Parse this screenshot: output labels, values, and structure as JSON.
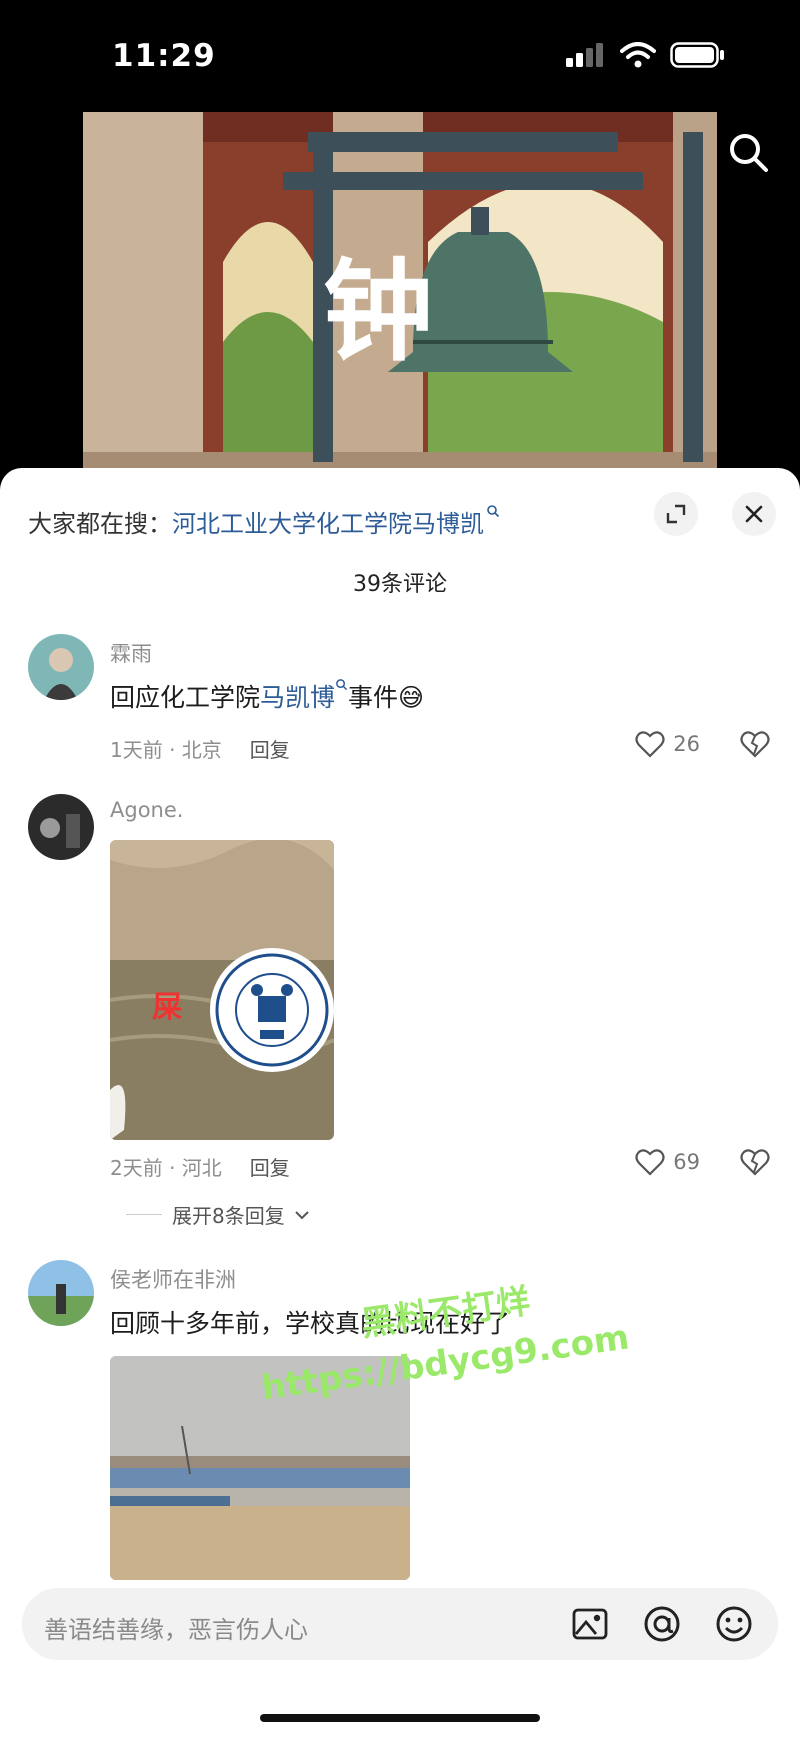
{
  "status_bar": {
    "time": "11:29"
  },
  "video": {
    "overlay_text": "钟"
  },
  "panel": {
    "hot_search_prefix": "大家都在搜：",
    "hot_search_link": "河北工业大学化工学院马博凯",
    "comment_count": "39条评论"
  },
  "comments": [
    {
      "username": "霖雨",
      "text_before": "回应化工学院",
      "text_link": "马凯博",
      "text_after": "事件",
      "emoji": "😅",
      "meta": "1天前 · 北京",
      "reply": "回复",
      "likes": "26"
    },
    {
      "username": "Agone.",
      "image_caption": "屎",
      "meta": "2天前 · 河北",
      "reply": "回复",
      "likes": "69",
      "expand": "展开8条回复"
    },
    {
      "username": "侯老师在非洲",
      "text": "回顾十多年前，学校真的比现在好了"
    }
  ],
  "watermark": {
    "line1": "黑料不打烊",
    "line2": "https://bdycg9.com"
  },
  "input": {
    "placeholder": "善语结善缘，恶言伤人心"
  },
  "colors": {
    "link": "#2e5c97",
    "sheet": "#ffffff",
    "input_bg": "#f2f2f2"
  }
}
